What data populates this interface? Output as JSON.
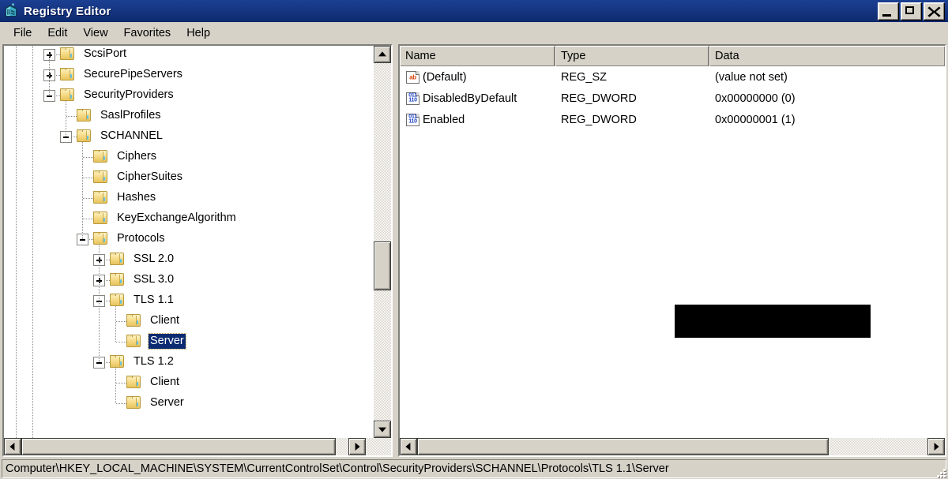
{
  "window": {
    "title": "Registry Editor",
    "icon": "regedit-icon",
    "controls": {
      "minimize": "Minimize",
      "maximize": "Maximize",
      "close": "Close"
    }
  },
  "menu": {
    "items": [
      {
        "label": "File"
      },
      {
        "label": "Edit"
      },
      {
        "label": "View"
      },
      {
        "label": "Favorites"
      },
      {
        "label": "Help"
      }
    ]
  },
  "tree": {
    "nodes": [
      {
        "label": "ScsiPort",
        "depth": 4,
        "toggle": "plus",
        "selected": false
      },
      {
        "label": "SecurePipeServers",
        "depth": 4,
        "toggle": "plus",
        "selected": false
      },
      {
        "label": "SecurityProviders",
        "depth": 4,
        "toggle": "minus",
        "selected": false
      },
      {
        "label": "SaslProfiles",
        "depth": 5,
        "toggle": "none",
        "selected": false
      },
      {
        "label": "SCHANNEL",
        "depth": 5,
        "toggle": "minus",
        "selected": false
      },
      {
        "label": "Ciphers",
        "depth": 6,
        "toggle": "none",
        "selected": false
      },
      {
        "label": "CipherSuites",
        "depth": 6,
        "toggle": "none",
        "selected": false
      },
      {
        "label": "Hashes",
        "depth": 6,
        "toggle": "none",
        "selected": false
      },
      {
        "label": "KeyExchangeAlgorithm",
        "depth": 6,
        "toggle": "none",
        "selected": false
      },
      {
        "label": "Protocols",
        "depth": 6,
        "toggle": "minus",
        "selected": false
      },
      {
        "label": "SSL 2.0",
        "depth": 7,
        "toggle": "plus",
        "selected": false
      },
      {
        "label": "SSL 3.0",
        "depth": 7,
        "toggle": "plus",
        "selected": false
      },
      {
        "label": "TLS 1.1",
        "depth": 7,
        "toggle": "minus",
        "selected": false
      },
      {
        "label": "Client",
        "depth": 8,
        "toggle": "none",
        "selected": false
      },
      {
        "label": "Server",
        "depth": 8,
        "toggle": "none",
        "selected": true
      },
      {
        "label": "TLS 1.2",
        "depth": 7,
        "toggle": "minus",
        "selected": false
      },
      {
        "label": "Client",
        "depth": 8,
        "toggle": "none",
        "selected": false
      },
      {
        "label": "Server",
        "depth": 8,
        "toggle": "none",
        "selected": false
      }
    ],
    "selected_label": "Server"
  },
  "list": {
    "columns": [
      {
        "label": "Name"
      },
      {
        "label": "Type"
      },
      {
        "label": "Data"
      }
    ],
    "rows": [
      {
        "icon": "string-value-icon",
        "icon_text": "ab",
        "name": "(Default)",
        "type": "REG_SZ",
        "data": "(value not set)"
      },
      {
        "icon": "dword-value-icon",
        "icon_text": "011",
        "name": "DisabledByDefault",
        "type": "REG_DWORD",
        "data": "0x00000000 (0)"
      },
      {
        "icon": "dword-value-icon",
        "icon_text": "011",
        "name": "Enabled",
        "type": "REG_DWORD",
        "data": "0x00000001 (1)"
      }
    ],
    "redaction": {
      "present": true,
      "label": "redacted-black-box"
    }
  },
  "statusbar": {
    "path": "Computer\\HKEY_LOCAL_MACHINE\\SYSTEM\\CurrentControlSet\\Control\\SecurityProviders\\SCHANNEL\\Protocols\\TLS 1.1\\Server"
  },
  "colors": {
    "titlebar": "#14337c",
    "selection": "#0b2a72",
    "chrome": "#d6d2c8",
    "string_icon": "#d8440c",
    "dword_icon": "#1a3fc4",
    "redaction": "#000000"
  }
}
